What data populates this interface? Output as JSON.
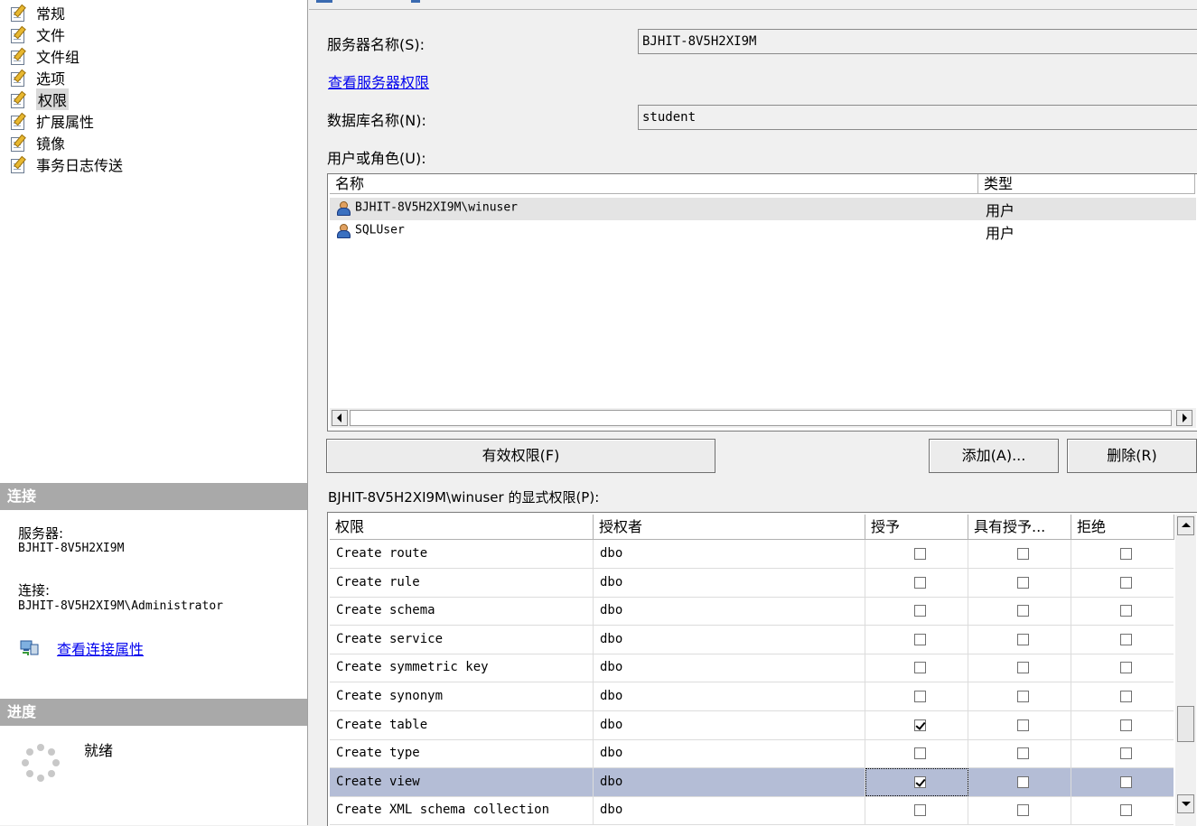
{
  "nav": {
    "items": [
      {
        "label": "常规",
        "selected": false
      },
      {
        "label": "文件",
        "selected": false
      },
      {
        "label": "文件组",
        "selected": false
      },
      {
        "label": "选项",
        "selected": false
      },
      {
        "label": "权限",
        "selected": true
      },
      {
        "label": "扩展属性",
        "selected": false
      },
      {
        "label": "镜像",
        "selected": false
      },
      {
        "label": "事务日志传送",
        "selected": false
      }
    ]
  },
  "connection": {
    "header": "连接",
    "server_label": "服务器:",
    "server_value": "BJHIT-8V5H2XI9M",
    "conn_label": "连接:",
    "conn_value": "BJHIT-8V5H2XI9M\\Administrator",
    "view_props_link": "查看连接属性"
  },
  "progress": {
    "header": "进度",
    "status": "就绪"
  },
  "form": {
    "server_name_label": "服务器名称(S):",
    "server_name_value": "BJHIT-8V5H2XI9M",
    "view_server_perms_link": "查看服务器权限",
    "db_name_label": "数据库名称(N):",
    "db_name_value": "student",
    "users_label": "用户或角色(U):"
  },
  "users": {
    "col_name": "名称",
    "col_type": "类型",
    "rows": [
      {
        "name": "BJHIT-8V5H2XI9M\\winuser",
        "type": "用户",
        "selected": true
      },
      {
        "name": "SQLUser",
        "type": "用户",
        "selected": false
      }
    ]
  },
  "buttons": {
    "effective": "有效权限(F)",
    "add": "添加(A)...",
    "remove": "删除(R)"
  },
  "perms": {
    "label": "BJHIT-8V5H2XI9M\\winuser 的显式权限(P):",
    "col_perm": "权限",
    "col_grantor": "授权者",
    "col_grant": "授予",
    "col_with_grant": "具有授予...",
    "col_deny": "拒绝",
    "rows": [
      {
        "perm": "Create route",
        "grantor": "dbo",
        "grant": false,
        "with_grant": false,
        "deny": false,
        "selected": false
      },
      {
        "perm": "Create rule",
        "grantor": "dbo",
        "grant": false,
        "with_grant": false,
        "deny": false,
        "selected": false
      },
      {
        "perm": "Create schema",
        "grantor": "dbo",
        "grant": false,
        "with_grant": false,
        "deny": false,
        "selected": false
      },
      {
        "perm": "Create service",
        "grantor": "dbo",
        "grant": false,
        "with_grant": false,
        "deny": false,
        "selected": false
      },
      {
        "perm": "Create symmetric key",
        "grantor": "dbo",
        "grant": false,
        "with_grant": false,
        "deny": false,
        "selected": false
      },
      {
        "perm": "Create synonym",
        "grantor": "dbo",
        "grant": false,
        "with_grant": false,
        "deny": false,
        "selected": false
      },
      {
        "perm": "Create table",
        "grantor": "dbo",
        "grant": true,
        "with_grant": false,
        "deny": false,
        "selected": false
      },
      {
        "perm": "Create type",
        "grantor": "dbo",
        "grant": false,
        "with_grant": false,
        "deny": false,
        "selected": false
      },
      {
        "perm": "Create view",
        "grantor": "dbo",
        "grant": true,
        "with_grant": false,
        "deny": false,
        "selected": true
      },
      {
        "perm": "Create XML schema collection",
        "grantor": "dbo",
        "grant": false,
        "with_grant": false,
        "deny": false,
        "selected": false
      }
    ]
  },
  "colors": {
    "selection": "#b4bdd6",
    "section_header": "#a9a9a9",
    "link": "#0000ee"
  }
}
